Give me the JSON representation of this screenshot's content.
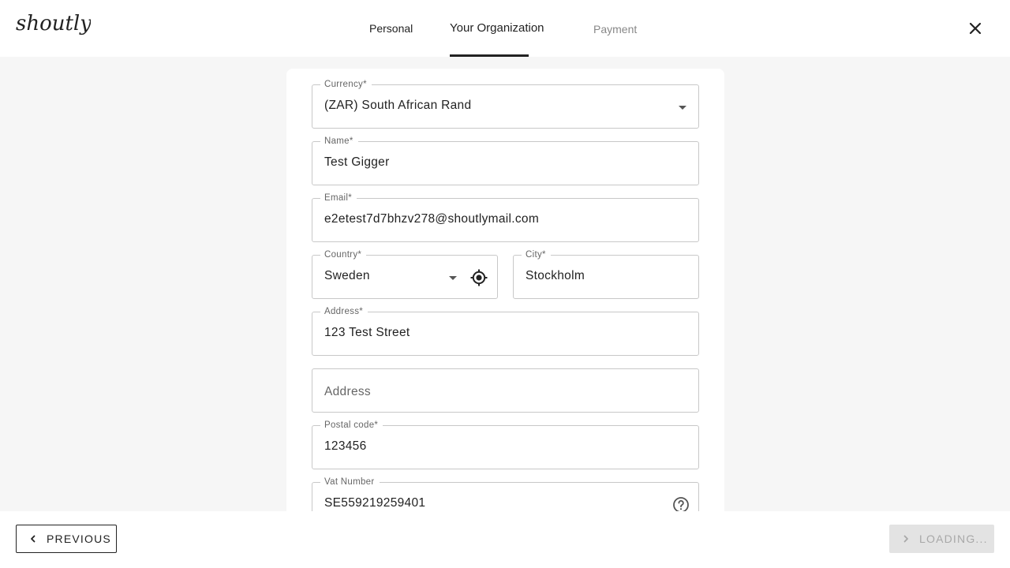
{
  "app": {
    "logo_text": "shoutly"
  },
  "tabs": [
    {
      "label": "Personal"
    },
    {
      "label": "Your Organization"
    },
    {
      "label": "Payment"
    }
  ],
  "form": {
    "currency": {
      "label": "Currency",
      "required_mark": "*",
      "value": "(ZAR) South African Rand"
    },
    "name": {
      "label": "Name",
      "required_mark": "*",
      "value": "Test Gigger"
    },
    "email": {
      "label": "Email",
      "required_mark": "*",
      "value": "e2etest7d7bhzv278@shoutlymail.com"
    },
    "country": {
      "label": "Country",
      "required_mark": "*",
      "value": "Sweden"
    },
    "city": {
      "label": "City",
      "required_mark": "*",
      "value": "Stockholm"
    },
    "address1": {
      "label": "Address",
      "required_mark": "*",
      "value": "123 Test Street"
    },
    "address2": {
      "placeholder": "Address",
      "value": ""
    },
    "postal_code": {
      "label": "Postal code",
      "required_mark": "*",
      "value": "123456"
    },
    "vat_number": {
      "label": "Vat Number",
      "value": "SE559219259401"
    }
  },
  "footer": {
    "previous_label": "PREVIOUS",
    "next_label": "LOADING..."
  },
  "icons": {
    "close": "close-icon",
    "locate": "my-location-icon",
    "help": "help-circle-icon",
    "dropdown": "caret-down-icon",
    "prev": "chevron-left-icon",
    "next": "chevron-right-icon"
  },
  "colors": {
    "background": "#f6f6f6",
    "surface": "#ffffff",
    "text": "#222222",
    "muted": "#888888",
    "disabled_bg": "#e3e3e3",
    "disabled_text": "#a8a8a8"
  }
}
